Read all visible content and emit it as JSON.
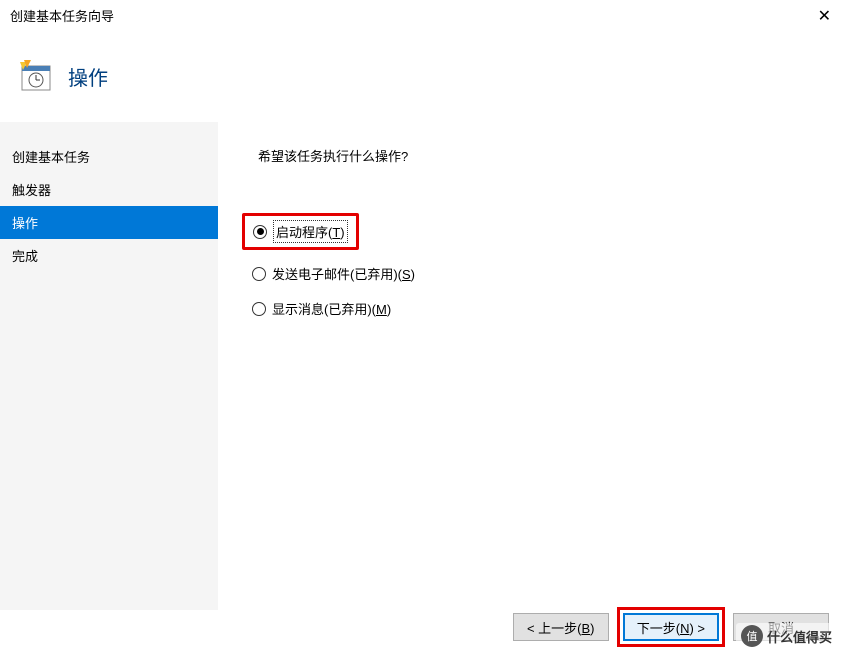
{
  "window": {
    "title": "创建基本任务向导",
    "close_symbol": "✕"
  },
  "header": {
    "icon_name": "task-scheduler-icon",
    "title": "操作"
  },
  "sidebar": {
    "items": [
      {
        "label": "创建基本任务",
        "active": false
      },
      {
        "label": "触发器",
        "active": false
      },
      {
        "label": "操作",
        "active": true
      },
      {
        "label": "完成",
        "active": false
      }
    ]
  },
  "content": {
    "prompt": "希望该任务执行什么操作?",
    "options": [
      {
        "label": "启动程序",
        "accel": "T",
        "checked": true,
        "highlighted": true
      },
      {
        "label": "发送电子邮件(已弃用)",
        "accel": "S",
        "checked": false,
        "highlighted": false
      },
      {
        "label": "显示消息(已弃用)",
        "accel": "M",
        "checked": false,
        "highlighted": false
      }
    ]
  },
  "footer": {
    "back_label": "< 上一步",
    "back_accel": "B",
    "next_label": "下一步",
    "next_accel": "N",
    "next_suffix": " >",
    "cancel_label": "取消"
  },
  "watermark": {
    "badge": "值",
    "text": "什么值得买"
  },
  "colors": {
    "accent": "#0078d7",
    "highlight": "#e30000",
    "header_text": "#003f7f"
  }
}
